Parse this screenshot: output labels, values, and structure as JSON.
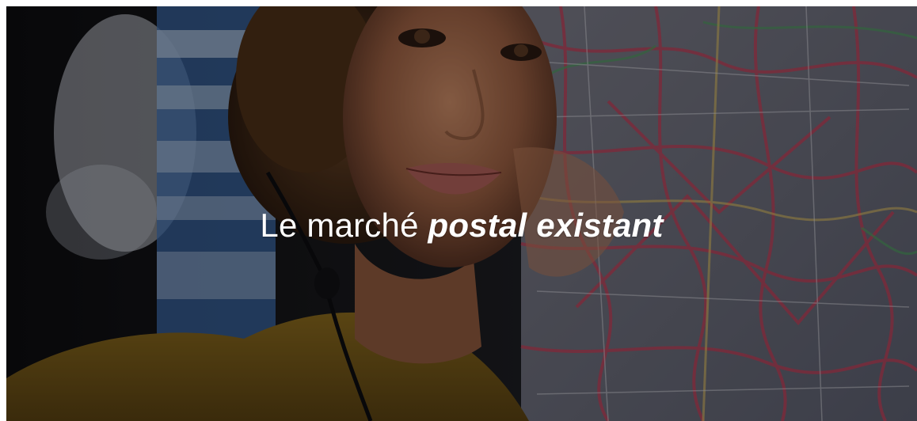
{
  "hero": {
    "title_plain": "Le marché ",
    "title_emphasis": "postal existant",
    "background_image": "woman-with-headset-and-city-map",
    "overlay_color": "#000000"
  }
}
